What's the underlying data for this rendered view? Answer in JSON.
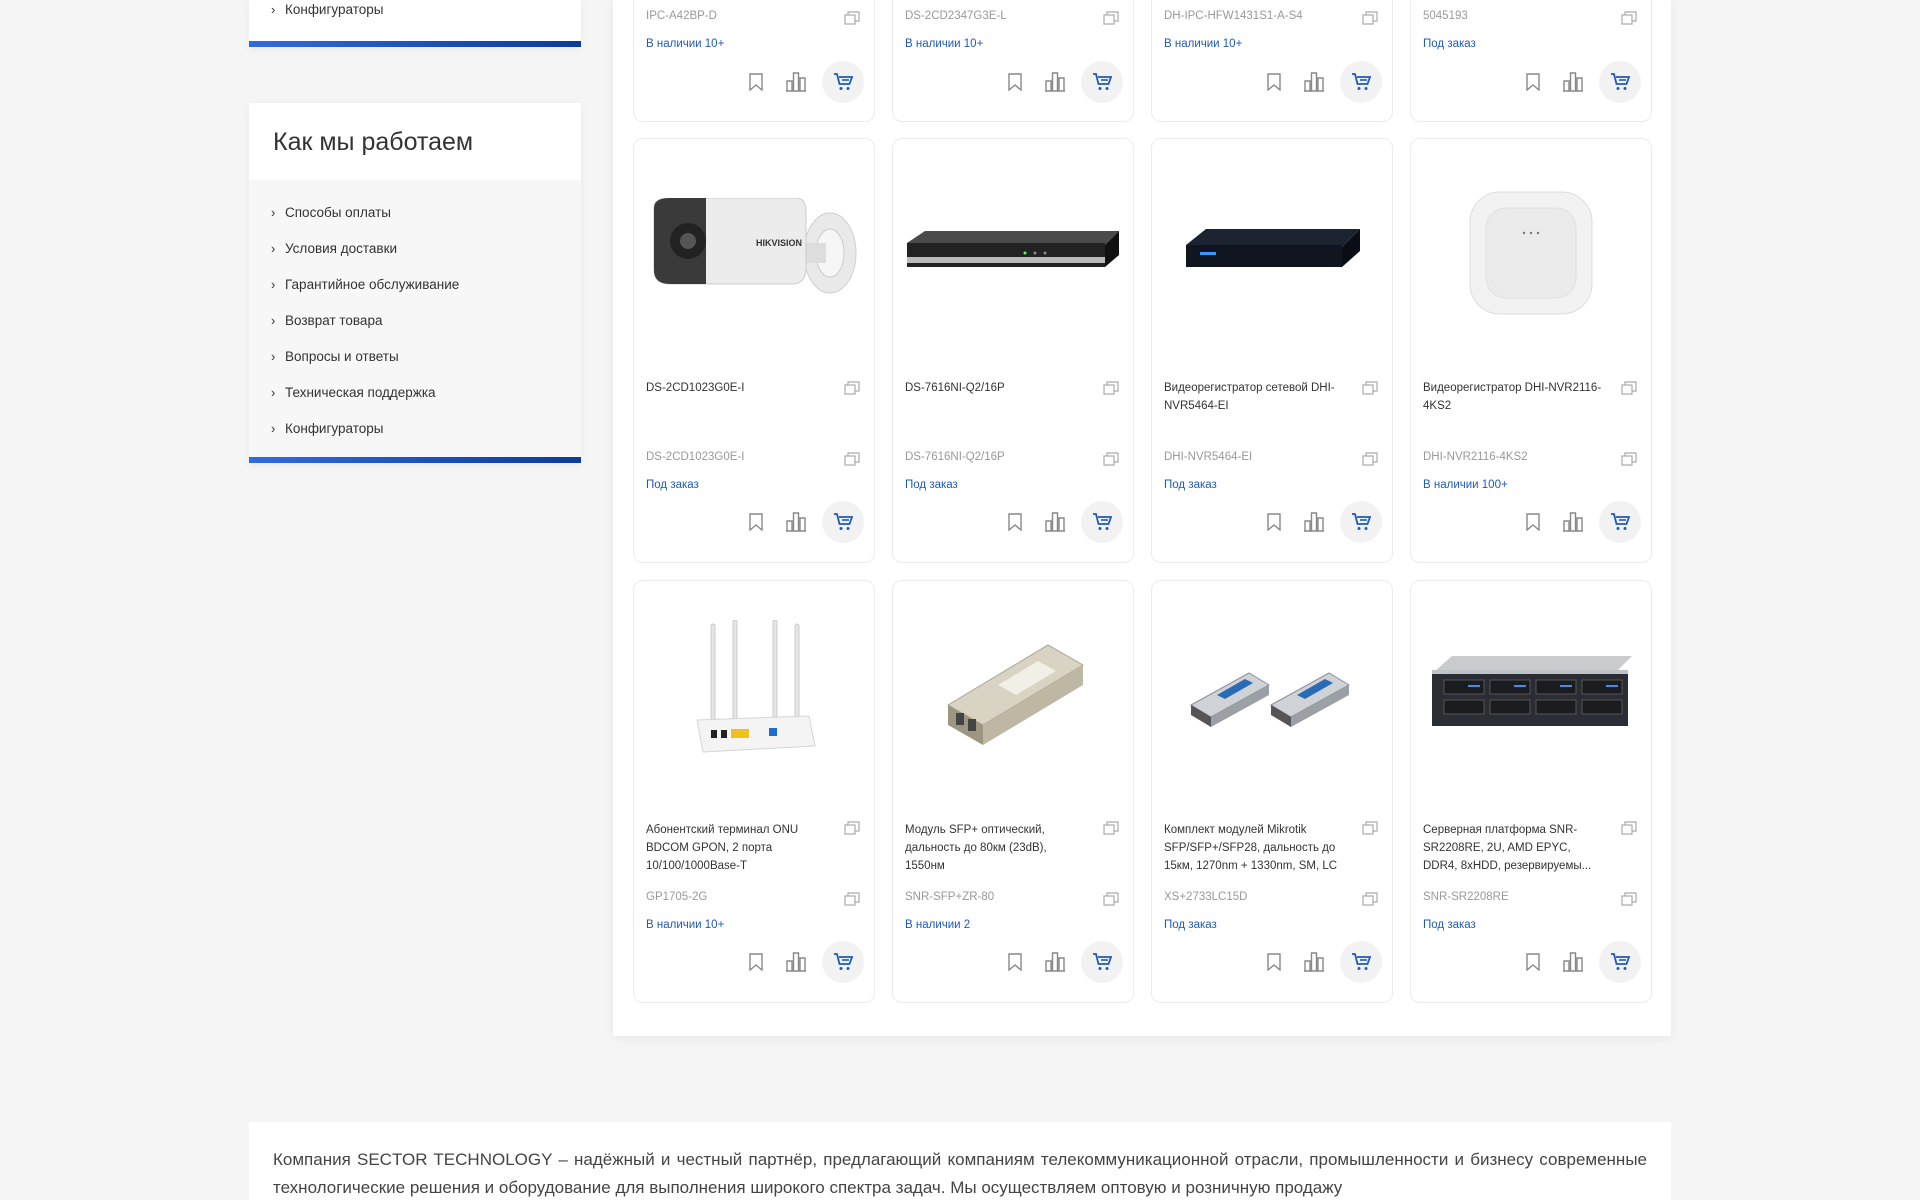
{
  "sidebar_top": {
    "last_item": "Конфигураторы"
  },
  "how_we_work": {
    "title": "Как мы работаем",
    "items": [
      "Способы оплаты",
      "Условия доставки",
      "Гарантийное обслуживание",
      "Возврат товара",
      "Вопросы и ответы",
      "Техническая поддержка",
      "Конфигураторы"
    ]
  },
  "products": [
    {
      "sku": "IPC-A42BP-D",
      "stock": "В наличии 10+"
    },
    {
      "sku": "DS-2CD2347G3E-L",
      "stock": "В наличии 10+"
    },
    {
      "sku": "DH-IPC-HFW1431S1-A-S4",
      "stock": "В наличии 10+"
    },
    {
      "sku": "5045193",
      "stock": "Под заказ"
    },
    {
      "name": "DS-2CD1023G0E-I",
      "sku": "DS-2CD1023G0E-I",
      "stock": "Под заказ",
      "image": "bullet-camera"
    },
    {
      "name": "DS-7616NI-Q2/16P",
      "sku": "DS-7616NI-Q2/16P",
      "stock": "Под заказ",
      "image": "nvr-hikvision"
    },
    {
      "name": "Видеорегистратор сетевой DHI-NVR5464-EI",
      "sku": "DHI-NVR5464-EI",
      "stock": "Под заказ",
      "image": "nvr-dahua"
    },
    {
      "name": "Видеорегистратор DHI-NVR2116-4KS2",
      "sku": "DHI-NVR2116-4KS2",
      "stock": "В наличии 100+",
      "image": "nvr-white"
    },
    {
      "name": "Абонентский терминал ONU BDCOM GPON, 2 порта 10/100/1000Base-T",
      "sku": "GP1705-2G",
      "stock": "В наличии 10+",
      "image": "onu-router"
    },
    {
      "name": "Модуль SFP+ оптический, дальность до 80км (23dB), 1550нм",
      "sku": "SNR-SFP+ZR-80",
      "stock": "В наличии 2",
      "image": "sfp-module"
    },
    {
      "name": "Комплект модулей Mikrotik SFP/SFP+/SFP28, дальность до 15км, 1270nm + 1330nm, SM, LC",
      "sku": "XS+2733LC15D",
      "stock": "Под заказ",
      "image": "sfp-pair"
    },
    {
      "name": "Серверная платформа SNR-SR2208RE, 2U, AMD EPYC, DDR4, 8xHDD, резервируемы...",
      "sku": "SNR-SR2208RE",
      "stock": "Под заказ",
      "image": "server-2u"
    }
  ],
  "about": {
    "text": "Компания SECTOR TECHNOLOGY – надёжный и честный партнёр, предлагающий компаниям телекоммуникационной отрасли, промышленности и бизнесу современные технологические решения и оборудование для выполнения широкого спектра задач. Мы осуществляем оптовую и розничную продажу"
  },
  "colors": {
    "accent": "#1f5ab8",
    "bar_start": "#2f6ce0",
    "bar_end": "#0a3c98"
  }
}
